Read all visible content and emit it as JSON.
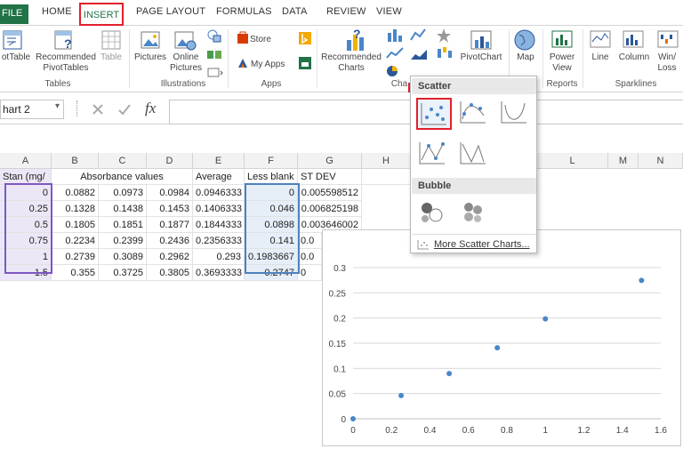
{
  "ribbon_tabs": {
    "file": "FILE",
    "home": "HOME",
    "insert": "INSERT",
    "page_layout": "PAGE LAYOUT",
    "formulas": "FORMULAS",
    "data": "DATA",
    "review": "REVIEW",
    "view": "VIEW"
  },
  "ribbon": {
    "pivottable": "otTable",
    "recommended_pivottables": "Recommended\nPivotTables",
    "table": "Table",
    "pictures": "Pictures",
    "online_pictures": "Online\nPictures",
    "store": "Store",
    "my_apps": "My Apps",
    "recommended_charts": "Recommended\nCharts",
    "pivotchart": "PivotChart",
    "map": "Map",
    "power_view": "Power\nView",
    "line": "Line",
    "column": "Column",
    "winloss": "Win/\nLoss",
    "groups": {
      "tables": "Tables",
      "illustrations": "Illustrations",
      "apps": "Apps",
      "charts": "Cha",
      "reports": "Reports",
      "sparklines": "Sparklines"
    }
  },
  "formula_bar": {
    "name_box": "hart 2",
    "fx": "fx",
    "value": ""
  },
  "columns": [
    "A",
    "B",
    "C",
    "D",
    "E",
    "F",
    "G",
    "H",
    "L",
    "M",
    "N"
  ],
  "headers": {
    "a": "Stan (mg/",
    "absorbance": "Absorbance values",
    "average": "Average",
    "less_blank": "Less blank",
    "stdev": "ST DEV"
  },
  "rows": [
    {
      "a": "0",
      "b": "0.0882",
      "c": "0.0973",
      "d": "0.0984",
      "e": "0.0946333",
      "f": "0",
      "g": "0.005598512"
    },
    {
      "a": "0.25",
      "b": "0.1328",
      "c": "0.1438",
      "d": "0.1453",
      "e": "0.1406333",
      "f": "0.046",
      "g": "0.006825198"
    },
    {
      "a": "0.5",
      "b": "0.1805",
      "c": "0.1851",
      "d": "0.1877",
      "e": "0.1844333",
      "f": "0.0898",
      "g": "0.003646002"
    },
    {
      "a": "0.75",
      "b": "0.2234",
      "c": "0.2399",
      "d": "0.2436",
      "e": "0.2356333",
      "f": "0.141",
      "g": "0.0"
    },
    {
      "a": "1",
      "b": "0.2739",
      "c": "0.3089",
      "d": "0.2962",
      "e": "0.293",
      "f": "0.1983667",
      "g": "0.0"
    },
    {
      "a": "1.5",
      "b": "0.355",
      "c": "0.3725",
      "d": "0.3805",
      "e": "0.3693333",
      "f": "0.2747",
      "g": "0"
    }
  ],
  "gallery": {
    "scatter_header": "Scatter",
    "bubble_header": "Bubble",
    "more_link": "More Scatter Charts..."
  },
  "colors": {
    "excel_green": "#217346",
    "highlight_red": "#e0202a",
    "marker_blue": "#4a86c8",
    "select_purple": "#7e57c2",
    "select_blue": "#4f81bd"
  },
  "chart_data": {
    "type": "scatter",
    "x": [
      0,
      0.25,
      0.5,
      0.75,
      1,
      1.5
    ],
    "y": [
      0,
      0.046,
      0.0898,
      0.141,
      0.1983667,
      0.2747
    ],
    "xticks": [
      "0",
      "0.2",
      "0.4",
      "0.6",
      "0.8",
      "1",
      "1.2",
      "1.4",
      "1.6"
    ],
    "yticks": [
      "0",
      "0.05",
      "0.1",
      "0.15",
      "0.2",
      "0.25",
      "0.3"
    ],
    "xlim": [
      0,
      1.6
    ],
    "ylim": [
      0,
      0.3
    ],
    "grid": "horizontal"
  }
}
